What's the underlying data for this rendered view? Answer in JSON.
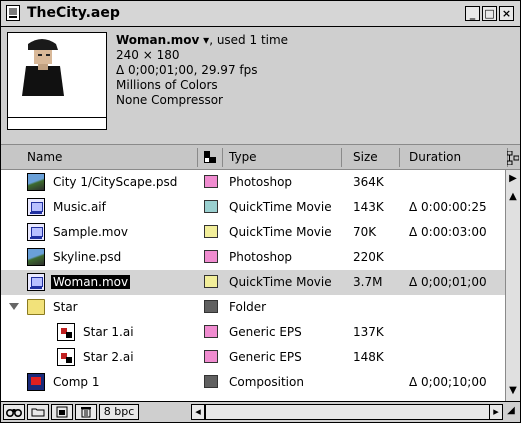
{
  "window": {
    "title": "TheCity.aep"
  },
  "info": {
    "file_name": "Woman.mov",
    "usage": ", used 1 time",
    "dimensions": "240 × 180",
    "duration_fps": "Δ 0;00;01;00, 29.97 fps",
    "colors": "Millions of Colors",
    "compressor": "None Compressor"
  },
  "columns": {
    "name": "Name",
    "type": "Type",
    "size": "Size",
    "duration": "Duration"
  },
  "rows": [
    {
      "name": "City 1/CityScape.psd",
      "type": "Photoshop",
      "size": "364K",
      "duration": "",
      "label_color": "#f08cd0",
      "icon": "photoshop-file-icon"
    },
    {
      "name": "Music.aif",
      "type": "QuickTime Movie",
      "size": "143K",
      "duration": "Δ 0:00:00:25",
      "label_color": "#9ad0d0",
      "icon": "quicktime-file-icon"
    },
    {
      "name": "Sample.mov",
      "type": "QuickTime Movie",
      "size": "70K",
      "duration": "Δ 0:00:03:00",
      "label_color": "#f2ee9a",
      "icon": "quicktime-file-icon"
    },
    {
      "name": "Skyline.psd",
      "type": "Photoshop",
      "size": "220K",
      "duration": "",
      "label_color": "#f08cd0",
      "icon": "photoshop-file-icon"
    },
    {
      "name": "Woman.mov",
      "type": "QuickTime Movie",
      "size": "3.7M",
      "duration": "Δ 0;00;01;00",
      "label_color": "#f2ee9a",
      "icon": "quicktime-file-icon"
    },
    {
      "name": "Star",
      "type": "Folder",
      "size": "",
      "duration": "",
      "label_color": "#606060",
      "icon": "folder-icon"
    },
    {
      "name": "Star 1.ai",
      "type": "Generic EPS",
      "size": "137K",
      "duration": "",
      "label_color": "#f08cd0",
      "icon": "illustrator-file-icon"
    },
    {
      "name": "Star 2.ai",
      "type": "Generic EPS",
      "size": "148K",
      "duration": "",
      "label_color": "#f08cd0",
      "icon": "illustrator-file-icon"
    },
    {
      "name": "Comp 1",
      "type": "Composition",
      "size": "",
      "duration": "Δ 0;00;10;00",
      "label_color": "#606060",
      "icon": "composition-icon"
    }
  ],
  "bottombar": {
    "depth_label": "8 bpc"
  }
}
